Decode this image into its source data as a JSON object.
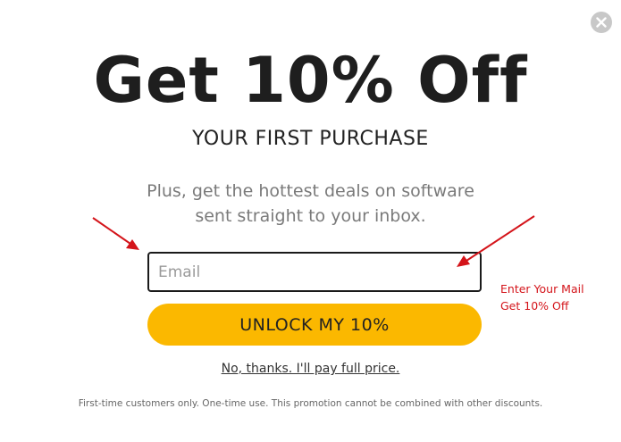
{
  "popup": {
    "headline": "Get 10% Off",
    "subheadline": "YOUR FIRST PURCHASE",
    "description_lines": [
      "Plus, get the hottest deals on software",
      "sent straight to your inbox."
    ],
    "email": {
      "placeholder": "Email",
      "value": ""
    },
    "unlock_button_label": "UNLOCK MY 10%",
    "decline_link": "No, thanks. I'll pay full price.",
    "fineprint": "First-time customers only. One-time use. This promotion cannot be combined with other discounts.",
    "close_icon": "close-icon"
  },
  "annotation": {
    "lines": [
      "Enter Your Mail",
      "Get 10% Off"
    ],
    "color": "#d4141a"
  },
  "colors": {
    "accent": "#fbb800",
    "headline": "#1e1e1e",
    "annotation": "#d4141a"
  }
}
